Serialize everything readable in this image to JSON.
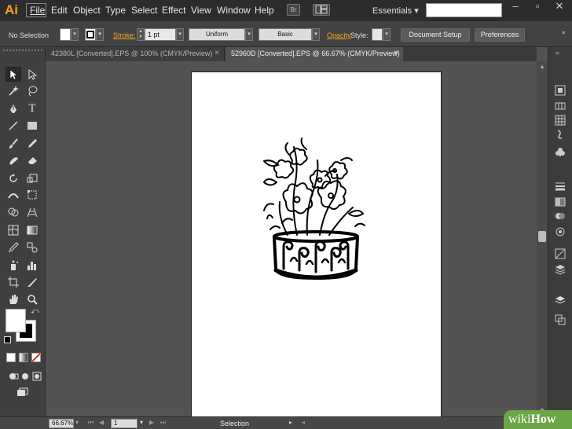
{
  "app": {
    "logo": "Ai"
  },
  "menubar": {
    "items": [
      "File",
      "Edit",
      "Object",
      "Type",
      "Select",
      "Effect",
      "View",
      "Window",
      "Help"
    ],
    "bridge_label": "Br",
    "workspace": "Essentials",
    "workspace_arrow": "▾"
  },
  "controlbar": {
    "selection_status": "No Selection",
    "stroke_label": "Stroke:",
    "stroke_weight": "1 pt",
    "profile": "Uniform",
    "brush": "Basic",
    "opacity_label": "Opacity",
    "style_label": "Style:",
    "document_setup": "Document Setup",
    "preferences": "Preferences"
  },
  "tabs": [
    {
      "label": "42380L [Converted].EPS @ 100% (CMYK/Preview)",
      "active": false
    },
    {
      "label": "52960D [Converted].EPS @ 66.67% (CMYK/Preview)",
      "active": true
    }
  ],
  "tab_close": "×",
  "statusbar": {
    "zoom": "66.67%",
    "artboard_number": "1",
    "status": "Selection"
  },
  "watermark": {
    "prefix": "wiki",
    "suffix": "How"
  },
  "colors": {
    "accent": "#f7a21b",
    "link": "#f5a623",
    "watermark": "#6aa646",
    "ui_dark": "#424242"
  },
  "icons": {
    "tools": [
      "selection-tool",
      "direct-selection-tool",
      "magic-wand-tool",
      "lasso-tool",
      "pen-tool",
      "type-tool",
      "line-tool",
      "rectangle-tool",
      "paintbrush-tool",
      "pencil-tool",
      "blob-brush-tool",
      "eraser-tool",
      "rotate-tool",
      "scale-tool",
      "width-tool",
      "free-transform-tool",
      "shape-builder-tool",
      "perspective-grid-tool",
      "mesh-tool",
      "gradient-tool",
      "eyedropper-tool",
      "blend-tool",
      "symbol-sprayer-tool",
      "column-graph-tool",
      "artboard-tool",
      "slice-tool",
      "hand-tool",
      "zoom-tool"
    ]
  }
}
